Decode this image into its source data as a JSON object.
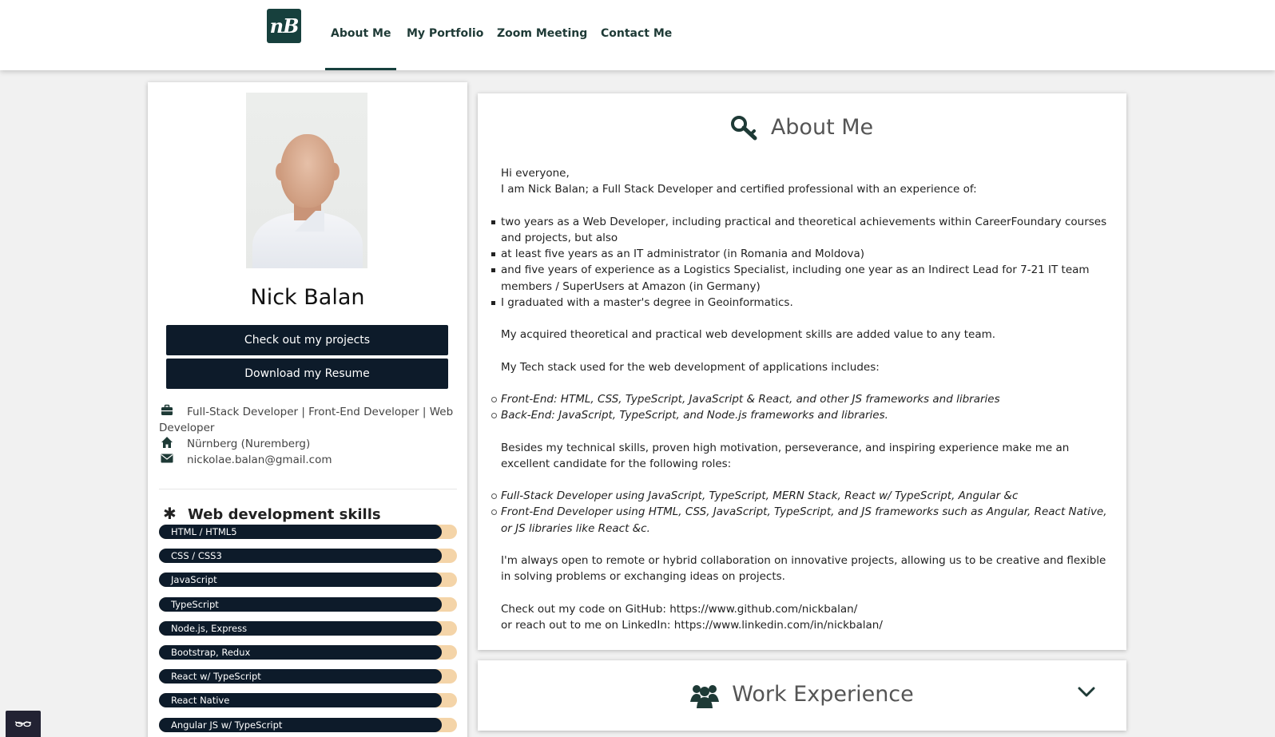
{
  "nav": {
    "logo_text": "nB",
    "items": [
      "About Me",
      "My Portfolio",
      "Zoom Meeting",
      "Contact Me"
    ],
    "active": "About Me"
  },
  "profile": {
    "name": "Nick Balan",
    "buttons": [
      "Check out my projects",
      "Download my Resume"
    ],
    "role_line1": "Full-Stack Developer | Front-End Developer | Web",
    "role_line2": "Developer",
    "location": "Nürnberg (Nuremberg)",
    "email": "nickolae.balan@gmail.com",
    "icons": [
      "briefcase-icon",
      "home-icon",
      "envelope-icon",
      "asterisk-icon"
    ]
  },
  "skills": {
    "title": "Web development skills",
    "items": [
      {
        "label": "HTML / HTML5",
        "level": 0.95
      },
      {
        "label": "CSS / CSS3",
        "level": 0.95
      },
      {
        "label": "JavaScript",
        "level": 0.95
      },
      {
        "label": "TypeScript",
        "level": 0.95
      },
      {
        "label": "Node.js, Express",
        "level": 0.95
      },
      {
        "label": "Bootstrap, Redux",
        "level": 0.95
      },
      {
        "label": "React w/ TypeScript",
        "level": 0.95
      },
      {
        "label": "React Native",
        "level": 0.95
      },
      {
        "label": "Angular JS w/ TypeScript",
        "level": 0.95
      }
    ]
  },
  "about": {
    "title": "About Me",
    "greeting": "Hi everyone,",
    "intro": "I am Nick Balan; a Full Stack Developer and certified professional with an experience of:",
    "experience": [
      "two years as a Web Developer, including practical and theoretical achievements within CareerFoundary courses and projects, but also",
      "at least five years as an IT administrator (in Romania and Moldova)",
      "and five years of experience as a Logistics Specialist, including one year as an Indirect Lead for 7-21 IT team members / SuperUsers at Amazon (in Germany)",
      "I graduated with a master's degree in Geoinformatics."
    ],
    "skills_value": "My acquired theoretical and practical web development skills are added value to any team.",
    "stack_intro": "My Tech stack used for the web development of applications includes:",
    "stack": [
      "Front-End: HTML, CSS, TypeScript, JavaScript & React, and other JS frameworks and libraries",
      "Back-End: JavaScript, TypeScript, and Node.js frameworks and libraries."
    ],
    "roles_intro": "Besides my technical skills, proven high motivation, perseverance, and inspiring experience make me an excellent candidate for the following roles:",
    "roles": [
      "Full-Stack Developer using JavaScript, TypeScript, MERN Stack, React w/ TypeScript, Angular &c",
      "Front-End Developer using HTML, CSS, JavaScript, TypeScript, and JS frameworks such as Angular, React Native, or JS libraries like React &c."
    ],
    "collab": "I'm always open to remote or hybrid collaboration on innovative projects, allowing us to be creative and flexible in solving problems or exchanging ideas on projects.",
    "github": "Check out my code on GitHub: https://www.github.com/nickbalan/",
    "linkedin": "or reach out to me on LinkedIn: https://www.linkedin.com/in/nickbalan/"
  },
  "work": {
    "title": "Work Experience"
  },
  "colors": {
    "brand": "#17403d",
    "button": "#0d1b2a",
    "skill_track": "#f4d4a8"
  }
}
